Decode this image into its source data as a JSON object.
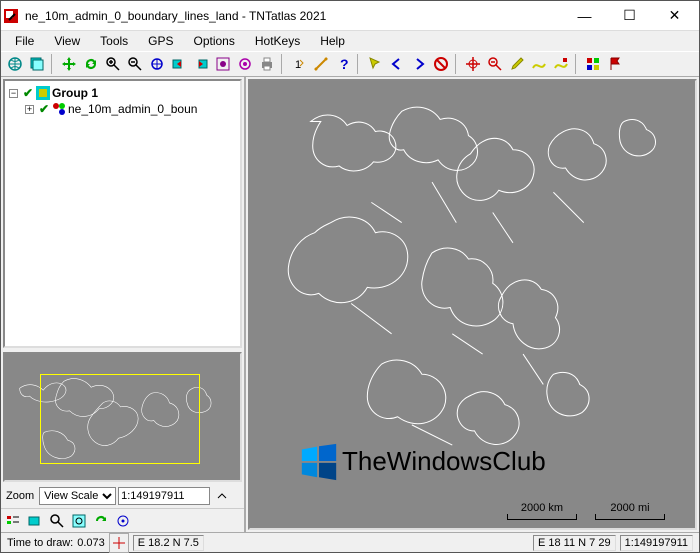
{
  "window": {
    "title": "ne_10m_admin_0_boundary_lines_land - TNTatlas 2021"
  },
  "menu": {
    "file": "File",
    "view": "View",
    "tools": "Tools",
    "gps": "GPS",
    "options": "Options",
    "hotkeys": "HotKeys",
    "help": "Help"
  },
  "tree": {
    "group_label": "Group 1",
    "layer_label": "ne_10m_admin_0_boun"
  },
  "zoom": {
    "label": "Zoom",
    "mode": "View Scale",
    "value": "1:149197911"
  },
  "status": {
    "time_label": "Time to draw:",
    "time_value": "0.073",
    "coord1": "E 18.2  N 7.5",
    "coord2": "E 18 11  N 7 29",
    "scale": "1:149197911"
  },
  "map": {
    "scale_km": "2000 km",
    "scale_mi": "2000 mi",
    "watermark": "TheWindowsClub"
  }
}
